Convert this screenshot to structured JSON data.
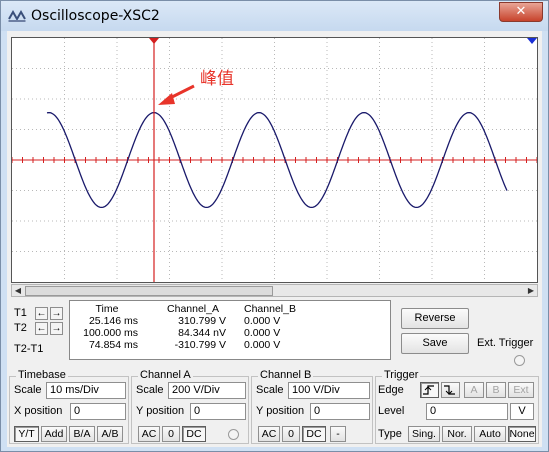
{
  "window": {
    "title": "Oscilloscope-XSC2",
    "close_glyph": "✕",
    "accent_color": "#c7432c"
  },
  "screen": {
    "annotation_text": "峰值",
    "annotation_color": "#e8342a",
    "trace_color": "#1a1a6b",
    "cursor_color": "#d42020",
    "t2_marker_color": "#1a2fd6",
    "grid_color": "#b8b8b8"
  },
  "chart_data": {
    "type": "line",
    "series": [
      {
        "values": [
          0,
          310.799,
          0,
          -310.799,
          0
        ]
      }
    ],
    "x_unit": "ms",
    "y_unit": "V",
    "timebase_ms_per_div": 10,
    "volts_per_div": 200,
    "waveform": "sine",
    "period_ms": 20,
    "amplitude_v": 310.799,
    "cycles_visible": 6,
    "grid": true,
    "cursor_t1_ms": 25.146,
    "cursor_t2_ms": 100.0
  },
  "readout": {
    "rows": [
      {
        "label": "T1",
        "time": "25.146 ms",
        "a": "310.799 V",
        "b": "0.000 V"
      },
      {
        "label": "T2",
        "time": "100.000 ms",
        "a": "84.344 nV",
        "b": "0.000 V"
      },
      {
        "label": "T2-T1",
        "time": "74.854 ms",
        "a": "-310.799 V",
        "b": "0.000 V"
      }
    ],
    "headers": {
      "time": "Time",
      "a": "Channel_A",
      "b": "Channel_B"
    },
    "left_arrow": "←",
    "right_arrow": "→"
  },
  "buttons": {
    "reverse": "Reverse",
    "save": "Save",
    "ext_trigger": "Ext. Trigger"
  },
  "timebase": {
    "title": "Timebase",
    "scale_label": "Scale",
    "scale_value": "10 ms/Div",
    "xpos_label": "X position",
    "xpos_value": "0",
    "modes": [
      "Y/T",
      "Add",
      "B/A",
      "A/B"
    ]
  },
  "channel_a": {
    "title": "Channel A",
    "scale_label": "Scale",
    "scale_value": "200  V/Div",
    "ypos_label": "Y position",
    "ypos_value": "0",
    "coupling": [
      "AC",
      "0",
      "DC"
    ]
  },
  "channel_b": {
    "title": "Channel B",
    "scale_label": "Scale",
    "scale_value": "100  V/Div",
    "ypos_label": "Y position",
    "ypos_value": "0",
    "coupling": [
      "AC",
      "0",
      "DC",
      "-"
    ]
  },
  "trigger": {
    "title": "Trigger",
    "edge_label": "Edge",
    "level_label": "Level",
    "level_value": "0",
    "level_unit": "V",
    "source_buttons": [
      "A",
      "B",
      "Ext"
    ],
    "type_label": "Type",
    "types": [
      "Sing.",
      "Nor.",
      "Auto",
      "None"
    ],
    "rising_edge_glyph": "ʃ",
    "falling_edge_glyph": "Ʒ"
  }
}
